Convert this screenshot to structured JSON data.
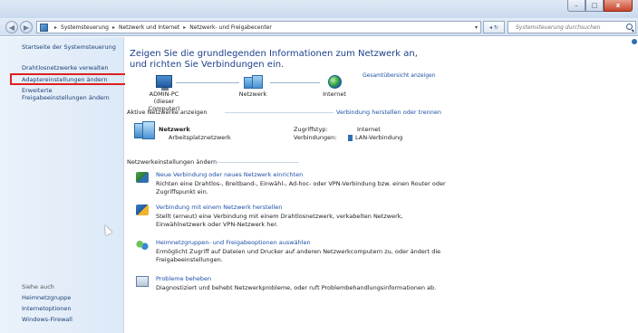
{
  "window": {
    "buttons": {
      "minimize": "–",
      "maximize": "□",
      "close": "x"
    }
  },
  "navbar": {
    "back": "◀",
    "forward": "▶",
    "breadcrumb": [
      "Systemsteuerung",
      "Netzwerk und Internet",
      "Netzwerk- und Freigabecenter"
    ],
    "separator": "▸",
    "dropdown": "▾",
    "refresh": "◂ ↻",
    "search_placeholder": "Systemsteuerung durchsuchen"
  },
  "sidebar": {
    "top_links": [
      "Startseite der Systemsteuerung",
      "Drahtlosnetzwerke verwalten",
      "Adaptereinstellungen ändern",
      "Erweiterte",
      "Freigabeeinstellungen ändern"
    ],
    "see_also": "Siehe auch",
    "bottom_links": [
      "Heimnetzgruppe",
      "Internetoptionen",
      "Windows-Firewall"
    ]
  },
  "main": {
    "heading": "Zeigen Sie die grundlegenden Informationen zum Netzwerk an, und richten Sie Verbindungen ein.",
    "overview_link": "Gesamtübersicht anzeigen",
    "map": {
      "pc_name": "ADMIN-PC",
      "pc_sub": "(dieser Computer)",
      "network": "Netzwerk",
      "internet": "Internet"
    },
    "active_section": "Aktive Netzwerke anzeigen",
    "connect_link": "Verbindung herstellen oder trennen",
    "active_net": {
      "name": "Netzwerk",
      "type": "Arbeitsplatznetzwerk",
      "access_label": "Zugriffstyp:",
      "access_value": "Internet",
      "conn_label": "Verbindungen:",
      "conn_value": "LAN-Verbindung"
    },
    "change_section": "Netzwerkeinstellungen ändern",
    "tasks": [
      {
        "title": "Neue Verbindung oder neues Netzwerk einrichten",
        "desc": "Richten eine Drahtlos-, Breitband-, Einwähl-, Ad-hoc- oder VPN-Verbindung bzw. einen Router oder Zugriffspunkt ein."
      },
      {
        "title": "Verbindung mit einem Netzwerk herstellen",
        "desc": "Stellt (erneut) eine Verbindung mit einem Drahtlosnetzwerk, verkabelten Netzwerk, Einwählnetzwerk oder VPN-Netzwerk her."
      },
      {
        "title": "Heimnetzgruppen- und Freigabeoptionen auswählen",
        "desc": "Ermöglicht Zugriff auf Dateien und Drucker auf anderen Netzwerkcomputern zu, oder ändert die Freigabeeinstellungen."
      },
      {
        "title": "Probleme beheben",
        "desc": "Diagnostiziert und behebt Netzwerkprobleme, oder ruft Problembehandlungsinformationen ab."
      }
    ]
  },
  "colors": {
    "highlight": "#e02020",
    "link": "#1c4fa6",
    "heading": "#1e3f8a"
  }
}
